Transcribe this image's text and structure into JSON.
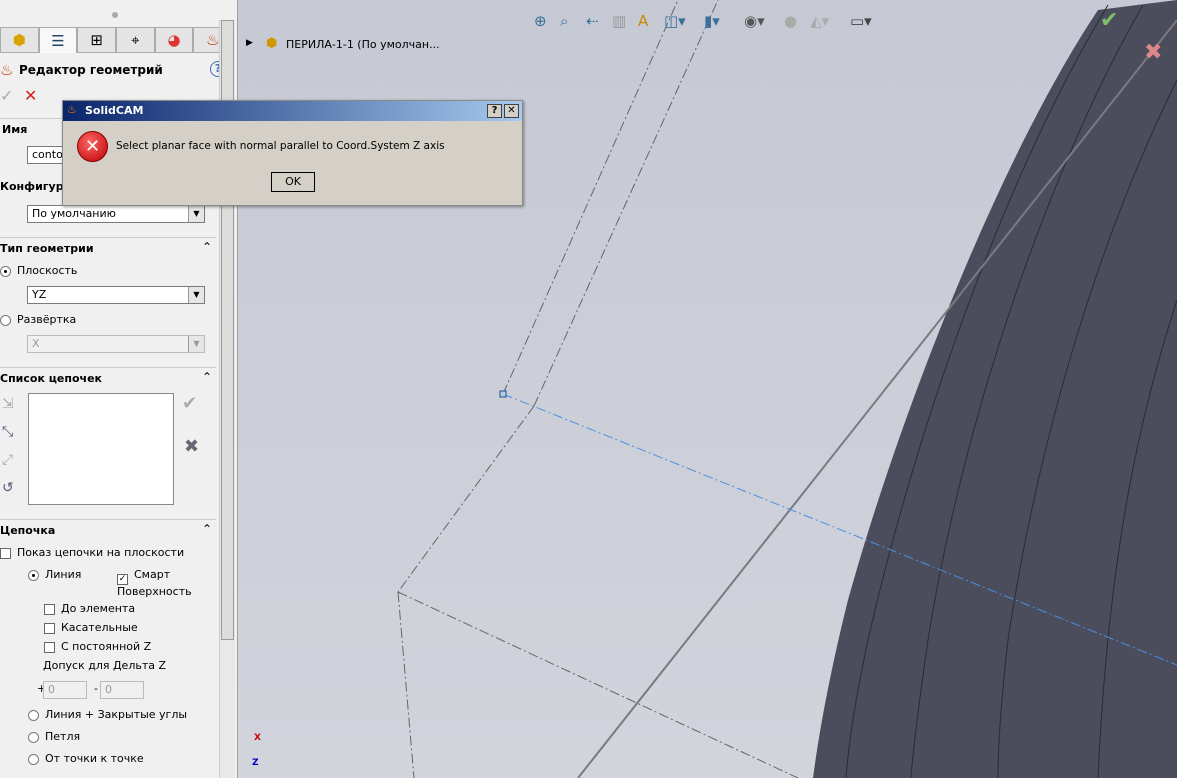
{
  "panel": {
    "tabs": [
      "part-icon",
      "property-icon",
      "tree-icon",
      "target-icon",
      "appearance-icon",
      "solidcam-icon"
    ],
    "title": "Редактор геометрий",
    "name_label": "Имя",
    "name_value": "conto",
    "config_label": "Конфигурац",
    "config_value": "По умолчанию",
    "geom_type": {
      "title": "Тип геометрии",
      "plane_label": "Плоскость",
      "plane_value": "YZ",
      "unfold_label": "Развёртка",
      "unfold_value": "X"
    },
    "chain_list": {
      "title": "Список цепочек"
    },
    "chain": {
      "title": "Цепочка",
      "show_on_plane": "Показ цепочки на плоскости",
      "line": "Линия",
      "smart_surface": "Смарт Поверхность",
      "to_element": "До элемента",
      "tangent": "Касательные",
      "const_z": "С постоянной Z",
      "delta_z": "Допуск для Дельта Z",
      "plus": "+",
      "minus": "-",
      "plus_value": "0",
      "minus_value": "0",
      "line_closed": "Линия + Закрытые углы",
      "loop": "Петля",
      "point_to_point": "От точки к точке"
    }
  },
  "tree": {
    "item": "ПЕРИЛА-1-1  (По умолчан..."
  },
  "dialog": {
    "title": "SolidCAM",
    "message": "Select planar face with normal parallel to Coord.System Z axis",
    "ok": "OK",
    "help": "?",
    "close": "✕"
  },
  "triad": {
    "x": "X",
    "z": "Z"
  },
  "colors": {
    "error": "#d32020",
    "accent": "#0a246a",
    "model": "#4b4d5c"
  }
}
